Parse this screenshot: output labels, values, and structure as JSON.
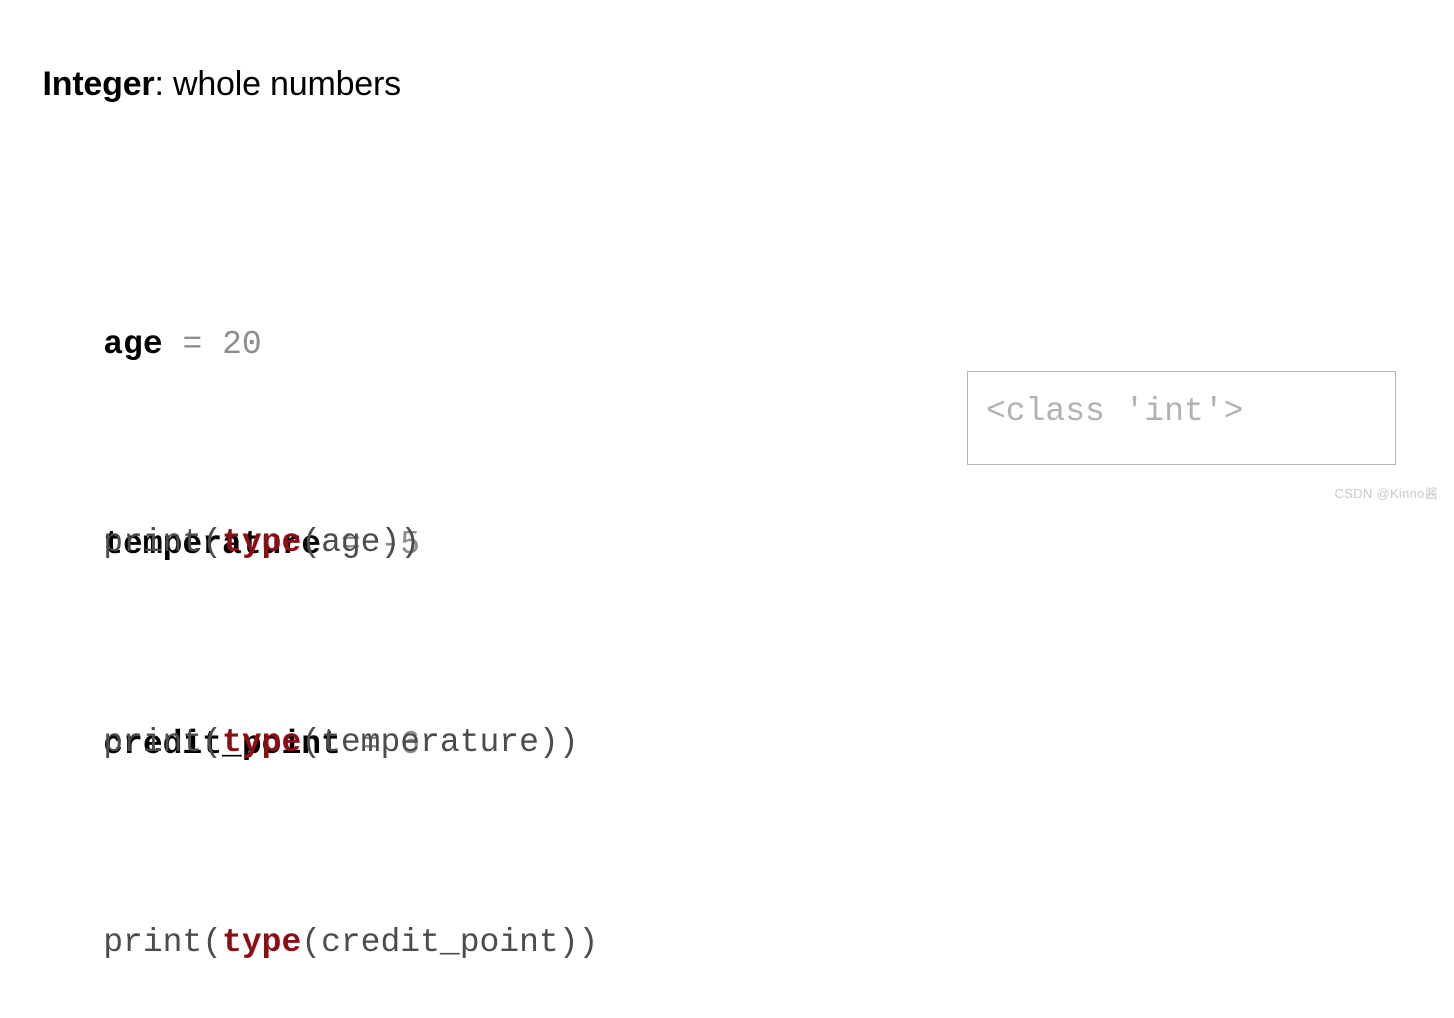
{
  "slide": {
    "title": {
      "term": "Integer",
      "description": ": whole numbers"
    },
    "background_color": "#ffffff"
  },
  "code": {
    "language": "python",
    "colors": {
      "variable": "#000000",
      "operator": "#8d8d8d",
      "number": "#8d8d8d",
      "plain": "#4c4c4c",
      "function": "#8c0d13"
    },
    "assignments": [
      {
        "raw": "age = 20",
        "variable": "age",
        "operator": " = ",
        "value": "20"
      },
      {
        "raw": "temperature = -5",
        "variable": "temperature",
        "operator": " = ",
        "value": "-5"
      },
      {
        "raw": "credit_point = 6",
        "variable": "credit_point",
        "operator": " = ",
        "value": "6"
      }
    ],
    "prints": [
      {
        "raw": "print(type(age))",
        "prefix": "print(",
        "function": "type",
        "suffix": "(age))"
      },
      {
        "raw": "print(type(temperature))",
        "prefix": "print(",
        "function": "type",
        "suffix": "(temperature))"
      },
      {
        "raw": "print(type(credit_point))",
        "prefix": "print(",
        "function": "type",
        "suffix": "(credit_point))"
      }
    ]
  },
  "output": {
    "text": "<class 'int'>",
    "border_color": "#b6b6b6",
    "text_color": "#b2b2b2"
  },
  "watermark": {
    "text": "CSDN @Kinno酱",
    "color": "#cacaca"
  }
}
